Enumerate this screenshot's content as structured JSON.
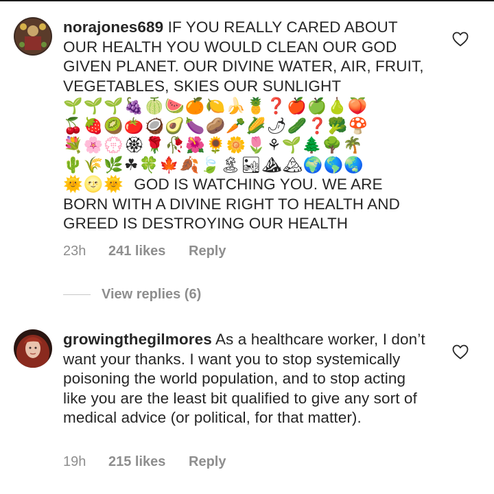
{
  "comments": [
    {
      "username": "norajones689",
      "text_start": "IF YOU REALLY CARED ABOUT OUR HEALTH YOU WOULD CLEAN OUR GOD GIVEN PLANET. OUR DIVINE WATER, AIR, FRUIT, VEGETABLES, SKIES OUR SUNLIGHT",
      "emoji_rows": [
        "🌱🌱🌱🍇🍈🍉🍊🍋🍌🍍❓🍎🍏🍐🍑",
        "🍒🍓🥝🍅🥥🥑🍆🥔🥕🌽🌶🥒❓🥦🍄",
        "💐🌸💮🏵🌹🥀🌺🌻🌼🌷⚘🌱🌲🌳🌴",
        "🌵🌾🌿☘🍀🍁🍂🍃🏝🏜⛰🏔🌍🌎🌏"
      ],
      "emoji_last": "🌞🌝🌞",
      "text_end": "GOD IS WATCHING YOU. WE ARE BORN WITH A DIVINE RIGHT TO HEALTH AND GREED IS DESTROYING OUR HEALTH",
      "time": "23h",
      "likes": "241 likes",
      "reply": "Reply",
      "view_replies": "View replies (6)"
    },
    {
      "username": "growingthegilmores",
      "text": "As a healthcare worker, I don’t want your thanks. I want you to stop systemically poisoning the world population, and to stop acting like you are the least bit qualified to give any sort of medical advice (or political, for that matter).",
      "time": "19h",
      "likes": "215 likes",
      "reply": "Reply"
    }
  ],
  "icons": {
    "like": "heart-outline-icon"
  },
  "colors": {
    "text": "#262626",
    "meta": "#8e8e8e"
  }
}
